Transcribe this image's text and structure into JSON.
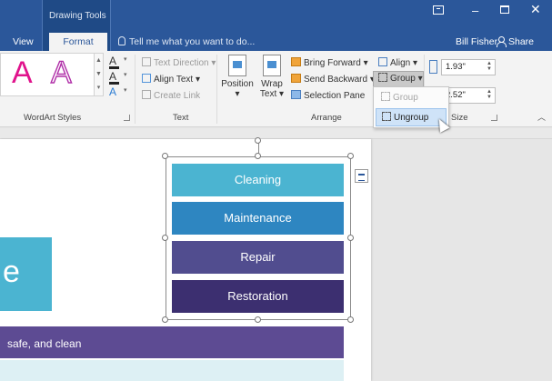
{
  "titlebar": {
    "contextual_label": "Drawing Tools",
    "tabs": [
      {
        "label": "View"
      },
      {
        "label": "Format"
      }
    ],
    "tell_me": "Tell me what you want to do...",
    "user_name": "Bill Fisher",
    "share_label": "Share",
    "window_buttons": {
      "minimize": "–",
      "close": "✕"
    }
  },
  "ribbon": {
    "wordart": {
      "group_label": "WordArt Styles",
      "sample_1": "A",
      "sample_2": "A",
      "fill_label": "A",
      "outline_label": "A",
      "effects_label": "A"
    },
    "text": {
      "group_label": "Text",
      "text_direction": "Text Direction",
      "align_text": "Align Text",
      "create_link": "Create Link"
    },
    "arrange": {
      "group_label": "Arrange",
      "position": "Position",
      "wrap_text_line1": "Wrap",
      "wrap_text_line2": "Text",
      "bring_forward": "Bring Forward",
      "send_backward": "Send Backward",
      "selection_pane": "Selection Pane",
      "align": "Align",
      "group": "Group"
    },
    "size": {
      "group_label": "Size",
      "height": "1.93\"",
      "width": "2.52\""
    }
  },
  "group_menu": {
    "items": [
      {
        "label": "Group",
        "enabled": false
      },
      {
        "label": "Ungroup",
        "enabled": true
      }
    ]
  },
  "document": {
    "title_letter": "e",
    "tagline": "safe, and clean",
    "shapes": [
      {
        "label": "Cleaning",
        "color": "#4bb4d1"
      },
      {
        "label": "Maintenance",
        "color": "#2e86c1"
      },
      {
        "label": "Repair",
        "color": "#514d8f"
      },
      {
        "label": "Restoration",
        "color": "#3c2f70"
      }
    ]
  },
  "colors": {
    "titlebar": "#2b579a",
    "accent_pink": "#e0138c",
    "accent_purple": "#b02fa8",
    "band": "#5d4b93"
  }
}
